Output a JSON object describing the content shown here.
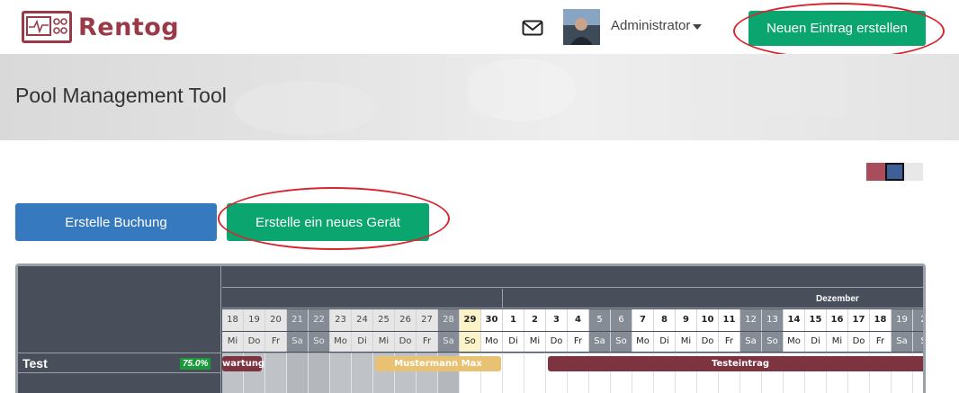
{
  "header": {
    "logo_text": "Rentog",
    "user_name": "Administrator",
    "new_entry_button": "Neuen Eintrag erstellen"
  },
  "banner": {
    "title": "Pool Management Tool"
  },
  "actions": {
    "create_booking": "Erstelle Buchung",
    "create_device": "Erstelle ein neues Gerät"
  },
  "theme_swatches": [
    "#a94c5b",
    "#3f5f96",
    "#e8e8e8"
  ],
  "calendar": {
    "month_label": "Dezember",
    "days": [
      {
        "num": "18",
        "dow": "Mi",
        "type": "past"
      },
      {
        "num": "19",
        "dow": "Do",
        "type": "past"
      },
      {
        "num": "20",
        "dow": "Fr",
        "type": "past"
      },
      {
        "num": "21",
        "dow": "Sa",
        "type": "past-we"
      },
      {
        "num": "22",
        "dow": "So",
        "type": "past-we"
      },
      {
        "num": "23",
        "dow": "Mo",
        "type": "past"
      },
      {
        "num": "24",
        "dow": "Di",
        "type": "past"
      },
      {
        "num": "25",
        "dow": "Mi",
        "type": "past"
      },
      {
        "num": "26",
        "dow": "Do",
        "type": "past"
      },
      {
        "num": "27",
        "dow": "Fr",
        "type": "past"
      },
      {
        "num": "28",
        "dow": "Sa",
        "type": "past-we"
      },
      {
        "num": "29",
        "dow": "So",
        "type": "today"
      },
      {
        "num": "30",
        "dow": "Mo",
        "type": "future"
      },
      {
        "num": "1",
        "dow": "Di",
        "type": "future"
      },
      {
        "num": "2",
        "dow": "Mi",
        "type": "future"
      },
      {
        "num": "3",
        "dow": "Do",
        "type": "future"
      },
      {
        "num": "4",
        "dow": "Fr",
        "type": "future"
      },
      {
        "num": "5",
        "dow": "Sa",
        "type": "weekend"
      },
      {
        "num": "6",
        "dow": "So",
        "type": "weekend"
      },
      {
        "num": "7",
        "dow": "Mo",
        "type": "future"
      },
      {
        "num": "8",
        "dow": "Di",
        "type": "future"
      },
      {
        "num": "9",
        "dow": "Mi",
        "type": "future"
      },
      {
        "num": "10",
        "dow": "Do",
        "type": "future"
      },
      {
        "num": "11",
        "dow": "Fr",
        "type": "future"
      },
      {
        "num": "12",
        "dow": "Sa",
        "type": "weekend"
      },
      {
        "num": "13",
        "dow": "So",
        "type": "weekend"
      },
      {
        "num": "14",
        "dow": "Mo",
        "type": "future"
      },
      {
        "num": "15",
        "dow": "Di",
        "type": "future"
      },
      {
        "num": "16",
        "dow": "Mi",
        "type": "future"
      },
      {
        "num": "17",
        "dow": "Do",
        "type": "future"
      },
      {
        "num": "18",
        "dow": "Fr",
        "type": "future"
      },
      {
        "num": "19",
        "dow": "Sa",
        "type": "weekend"
      },
      {
        "num": "2",
        "dow": "S",
        "type": "weekend"
      }
    ],
    "resource": {
      "name": "Test",
      "utilization": "75.0%"
    },
    "bookings": [
      {
        "label": "wartung",
        "color": "#7d3340",
        "start": 0,
        "span": 2
      },
      {
        "label": "Mustermann Max",
        "color": "#e8c272",
        "start": 7,
        "span": 6
      },
      {
        "label": "Testeintrag",
        "color": "#7d3340",
        "start": 15,
        "span": 18
      }
    ]
  }
}
